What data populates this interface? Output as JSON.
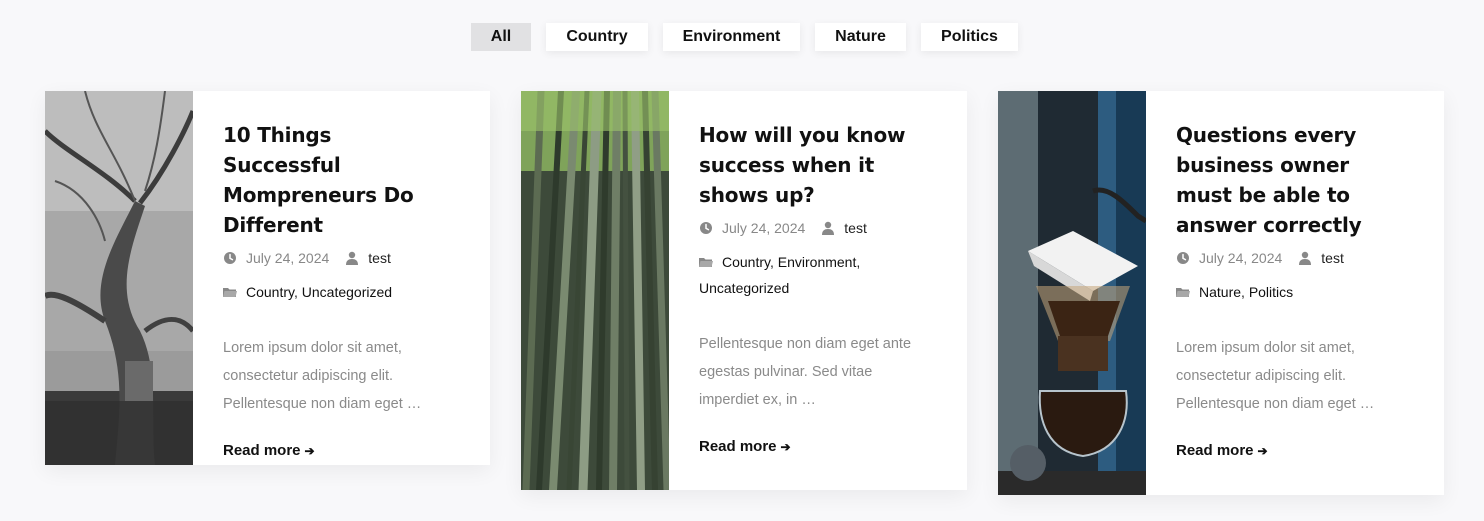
{
  "filters": [
    {
      "label": "All",
      "active": true
    },
    {
      "label": "Country",
      "active": false
    },
    {
      "label": "Environment",
      "active": false
    },
    {
      "label": "Nature",
      "active": false
    },
    {
      "label": "Politics",
      "active": false
    }
  ],
  "posts": [
    {
      "title": "10 Things Successful Mompreneurs Do Different",
      "date": "July 24, 2024",
      "author": "test",
      "categories": [
        "Country",
        "Uncategorized"
      ],
      "excerpt": "Lorem ipsum dolor sit amet, consectetur adipiscing elit. Pellentesque non diam eget …",
      "read_more": "Read more",
      "image": "black-and-white-tree-photo"
    },
    {
      "title": "How will you know success when it shows up?",
      "date": "July 24, 2024",
      "author": "test",
      "categories": [
        "Country",
        "Environment",
        "Uncategorized"
      ],
      "excerpt": "Pellentesque non diam eget ante egestas pulvinar. Sed vitae imperdiet ex, in …",
      "read_more": "Read more",
      "image": "bamboo-forest-photo"
    },
    {
      "title": "Questions every business owner must be able to answer correctly",
      "date": "July 24, 2024",
      "author": "test",
      "categories": [
        "Nature",
        "Politics"
      ],
      "excerpt": "Lorem ipsum dolor sit amet, consectetur adipiscing elit. Pellentesque non diam eget …",
      "read_more": "Read more",
      "image": "pour-over-coffee-photo"
    }
  ],
  "icons": {
    "date": "clock-icon",
    "author": "user-icon",
    "categories": "folder-icon",
    "read_more": "arrow-right-icon"
  },
  "colors": {
    "background": "#f8f8fa",
    "active_filter": "#e1e1e3",
    "text": "#111111",
    "muted": "#888888"
  }
}
